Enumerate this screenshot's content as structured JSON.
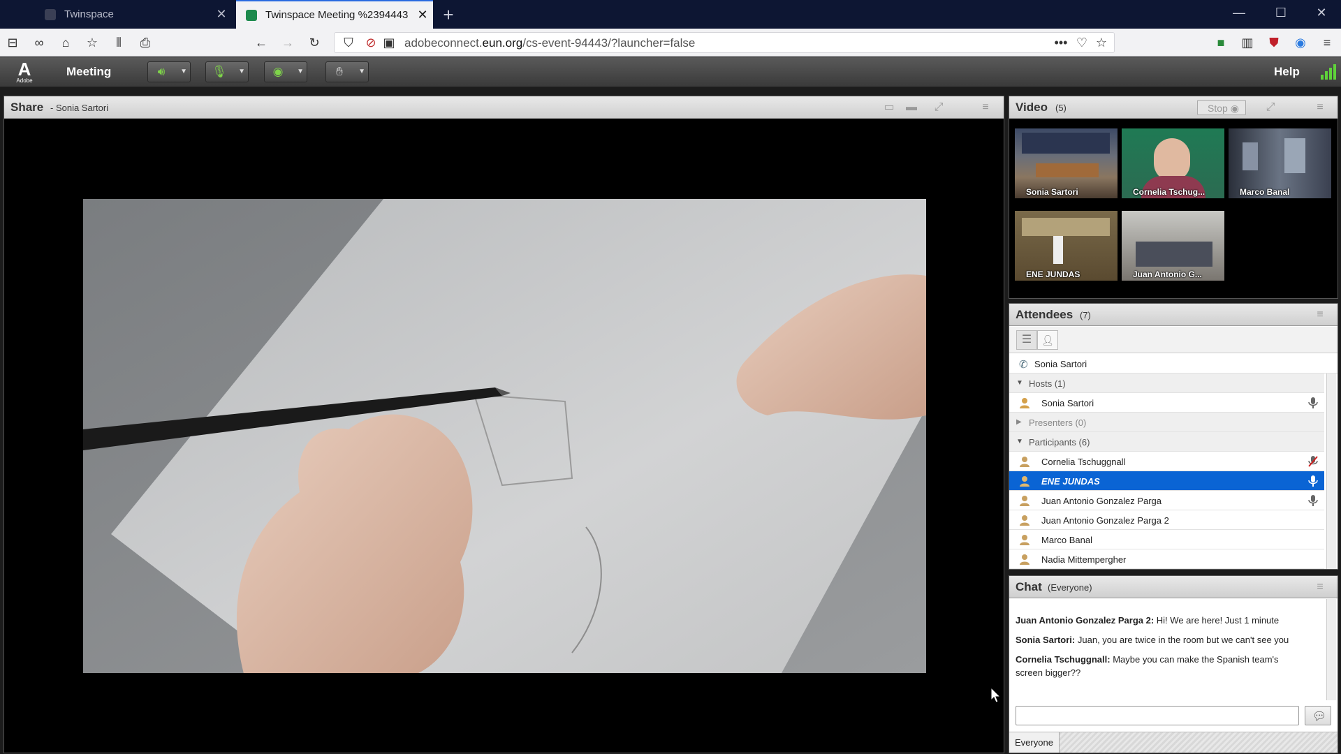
{
  "browser": {
    "tabs": [
      {
        "title": "Twinspace",
        "active": false
      },
      {
        "title": "Twinspace Meeting %2394443",
        "active": true
      }
    ],
    "url_prefix": "adobeconnect.",
    "url_domain": "eun.org",
    "url_path": "/cs-event-94443/?launcher=false"
  },
  "toolbar": {
    "logo_text": "Adobe",
    "meeting_label": "Meeting",
    "help_label": "Help"
  },
  "share": {
    "title": "Share",
    "presenter": "- Sonia Sartori"
  },
  "video": {
    "title": "Video",
    "count": "(5)",
    "stop_label": "Stop",
    "tiles": [
      {
        "name": "Sonia Sartori"
      },
      {
        "name": "Cornelia Tschug..."
      },
      {
        "name": "Marco Banal"
      },
      {
        "name": "ENE JUNDAS"
      },
      {
        "name": "Juan Antonio G..."
      }
    ]
  },
  "attendees": {
    "title": "Attendees",
    "count": "(7)",
    "phone_user": "Sonia Sartori",
    "hosts_label": "Hosts (1)",
    "hosts": [
      "Sonia Sartori"
    ],
    "presenters_label": "Presenters (0)",
    "participants_label": "Participants (6)",
    "participants": [
      "Cornelia Tschuggnall",
      "ENE JUNDAS",
      "Juan Antonio Gonzalez Parga",
      "Juan Antonio Gonzalez Parga 2",
      "Marco Banal",
      "Nadia Mittempergher"
    ]
  },
  "chat": {
    "title": "Chat",
    "audience": "(Everyone)",
    "messages": [
      {
        "sender": "Juan Antonio Gonzalez Parga 2:",
        "text": "Hi! We are here! Just 1 minute"
      },
      {
        "sender": "Sonia Sartori:",
        "text": "Juan, you are twice in the room but we can't see you"
      },
      {
        "sender": "Cornelia Tschuggnall:",
        "text": "Maybe you can make the Spanish team's screen bigger??"
      }
    ],
    "footer_tab": "Everyone"
  },
  "colors": {
    "accent_green": "#7fd44a",
    "selection_blue": "#0a64d4",
    "tab_bar": "#0d1633"
  }
}
